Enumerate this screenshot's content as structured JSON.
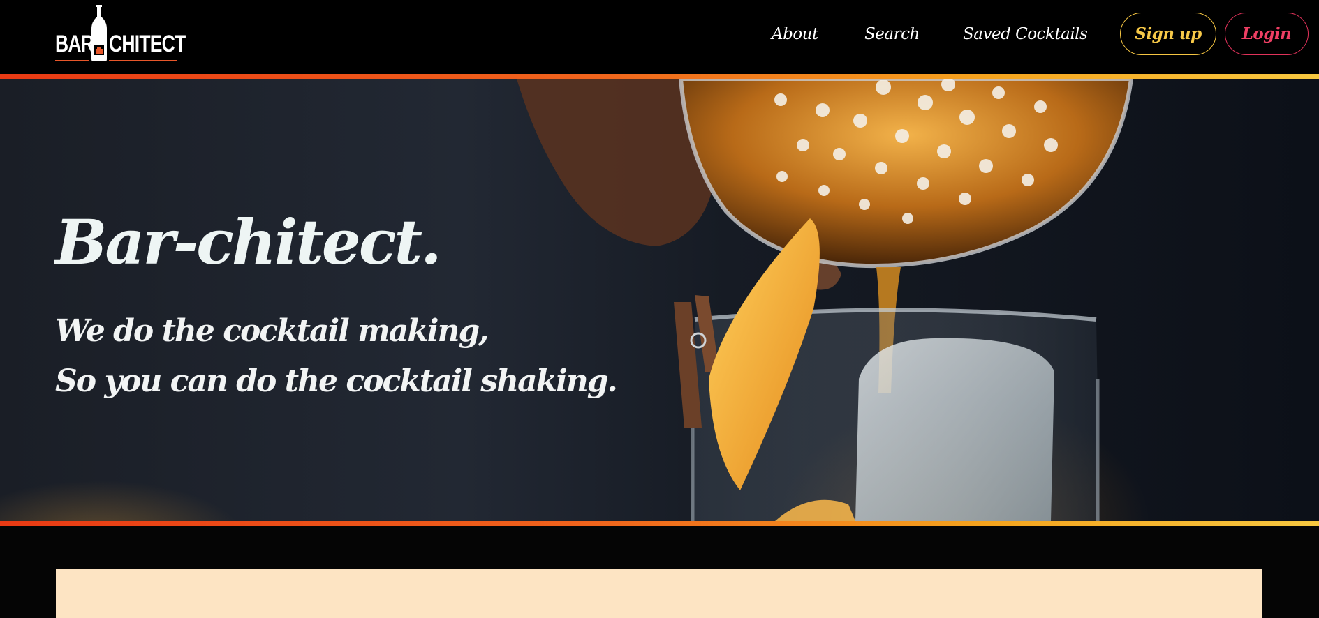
{
  "header": {
    "logo": {
      "left_text": "BAR",
      "right_text": "CHITECT",
      "icon": "bottle-and-glass-icon"
    },
    "nav": [
      {
        "label": "About"
      },
      {
        "label": "Search"
      },
      {
        "label": "Saved Cocktails"
      }
    ],
    "signup_label": "Sign up",
    "login_label": "Login"
  },
  "hero": {
    "title": "Bar-chitect.",
    "tagline_line1": "We do the cocktail making,",
    "tagline_line2": "So you can do the cocktail shaking.",
    "image": "cocktail-pouring-photo"
  },
  "colors": {
    "signup_accent": "#f7c948",
    "login_accent": "#ef3f64",
    "stripe_start": "#e93a14",
    "stripe_end": "#f7c840",
    "card_background": "#fde4c3"
  }
}
